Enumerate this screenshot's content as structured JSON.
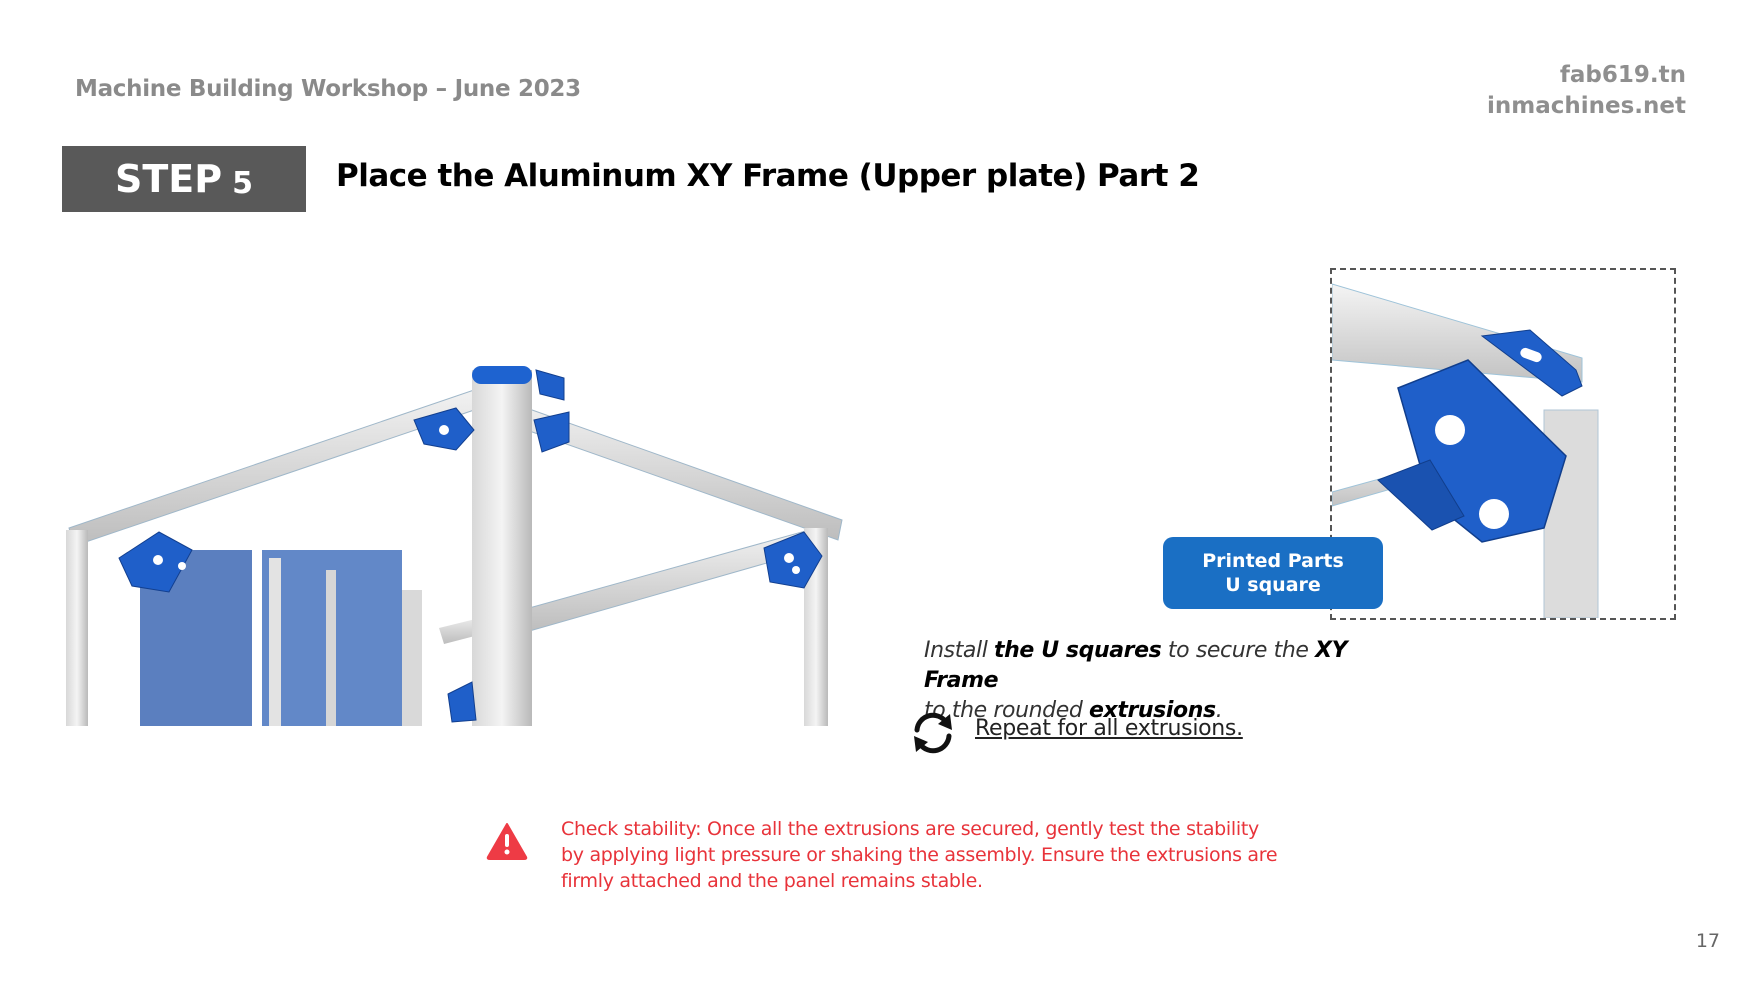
{
  "header": {
    "workshop": "Machine Building Workshop – June 2023",
    "site1": "fab619.tn",
    "site2": "inmachines.net"
  },
  "step": {
    "label": "STEP",
    "number": "5",
    "title": "Place the Aluminum XY Frame (Upper plate) Part 2"
  },
  "callout": {
    "line1": "Printed Parts",
    "line2": "U square"
  },
  "instruction": {
    "p1": "Install ",
    "b1": "the  U squares",
    "p2": " to secure the ",
    "b2": "XY Frame",
    "p3": "to the rounded ",
    "b3": "extrusions",
    "p4": "."
  },
  "repeat": {
    "text": "Repeat for all extrusions.",
    "icon": "refresh-icon"
  },
  "warning": {
    "text": "Check stability: Once all the extrusions are secured, gently test the stability by applying light pressure or shaking the assembly. Ensure the extrusions are firmly attached and the panel remains stable.",
    "icon": "warning-icon",
    "color": "#e8333a"
  },
  "page_number": "17",
  "colors": {
    "step_box": "#595959",
    "accent_blue": "#1a6fc4",
    "part_blue": "#1f5fc9"
  }
}
